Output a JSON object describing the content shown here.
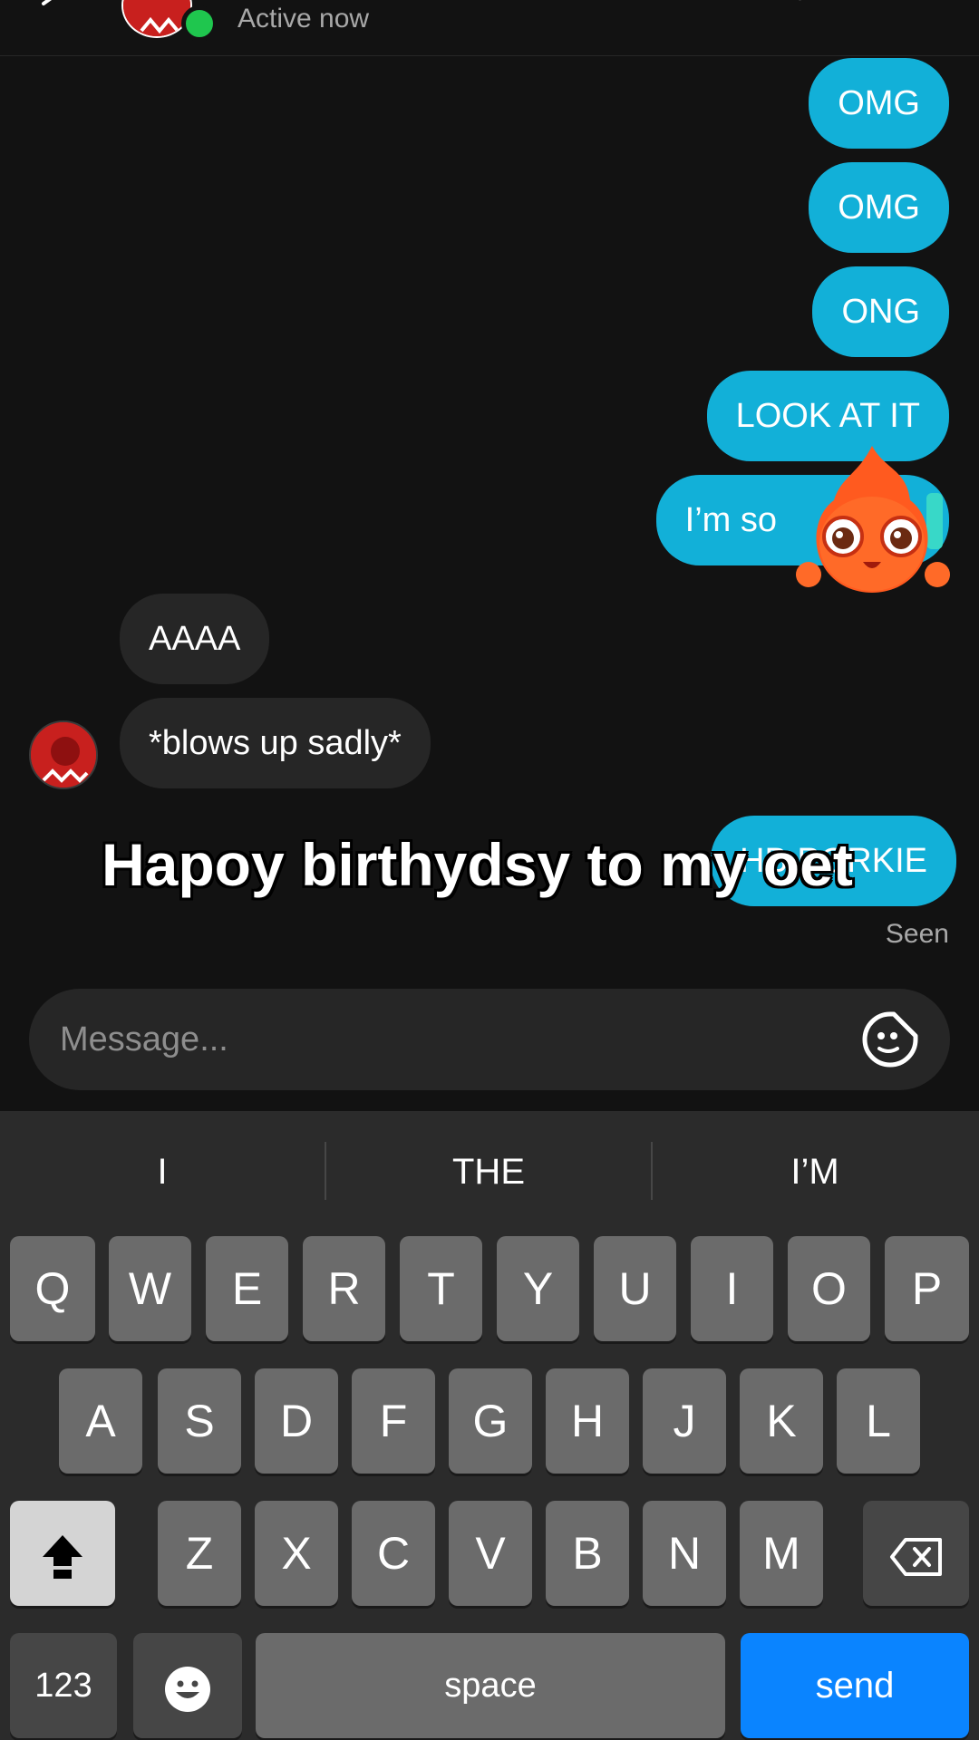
{
  "header": {
    "status": "Active now"
  },
  "messages": [
    {
      "dir": "out",
      "text": "OMG"
    },
    {
      "dir": "out",
      "text": "OMG"
    },
    {
      "dir": "out",
      "text": "ONG"
    },
    {
      "dir": "out",
      "text": "LOOK AT IT"
    },
    {
      "dir": "out",
      "text": "I’m so"
    },
    {
      "dir": "in",
      "text": "AAAA"
    },
    {
      "dir": "in",
      "text": "*blows up sadly*"
    },
    {
      "dir": "out",
      "text": "HB PORKIE"
    }
  ],
  "caption": "Hapoy birthydsy to my oet",
  "seen": "Seen",
  "composer": {
    "placeholder": "Message..."
  },
  "keyboard": {
    "suggestions": [
      "I",
      "THE",
      "I’M"
    ],
    "row1": [
      "Q",
      "W",
      "E",
      "R",
      "T",
      "Y",
      "U",
      "I",
      "O",
      "P"
    ],
    "row2": [
      "A",
      "S",
      "D",
      "F",
      "G",
      "H",
      "J",
      "K",
      "L"
    ],
    "row3": [
      "Z",
      "X",
      "C",
      "V",
      "B",
      "N",
      "M"
    ],
    "numbers_label": "123",
    "space_label": "space",
    "send_label": "send"
  },
  "colors": {
    "outgoing_bubble": "#12b0d8",
    "incoming_bubble": "#262626",
    "online": "#1fc64e",
    "send_key": "#0a84ff"
  }
}
